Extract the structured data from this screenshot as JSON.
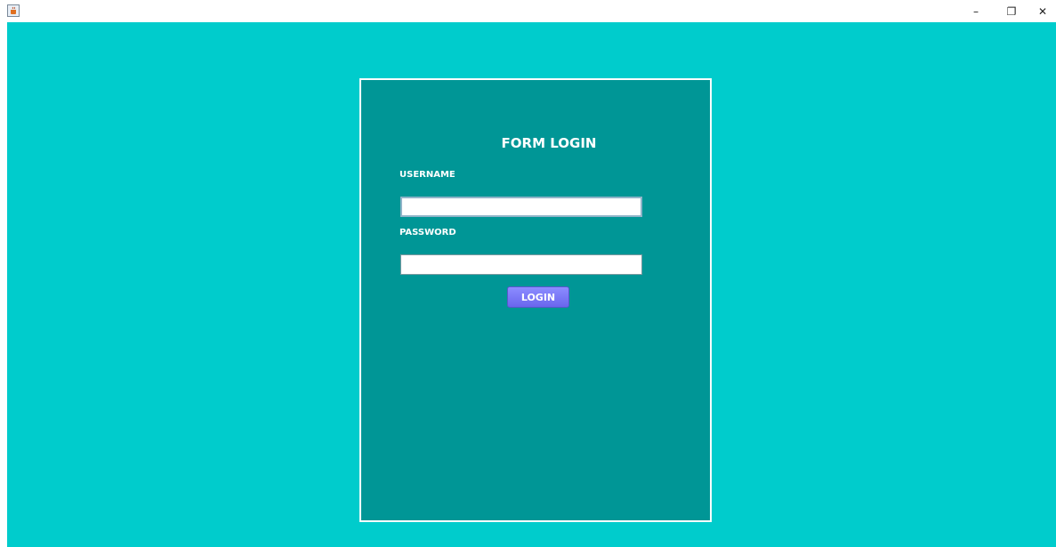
{
  "window": {
    "app_icon": "java-cup-icon",
    "minimize_glyph": "–",
    "restore_glyph": "❐",
    "close_glyph": "✕"
  },
  "form": {
    "title": "FORM LOGIN",
    "username_label": "USERNAME",
    "username_value": "",
    "password_label": "PASSWORD",
    "password_value": "",
    "login_button": "LOGIN"
  },
  "colors": {
    "background": "#00cccc",
    "panel": "#009696",
    "button": "#7b78f5"
  }
}
